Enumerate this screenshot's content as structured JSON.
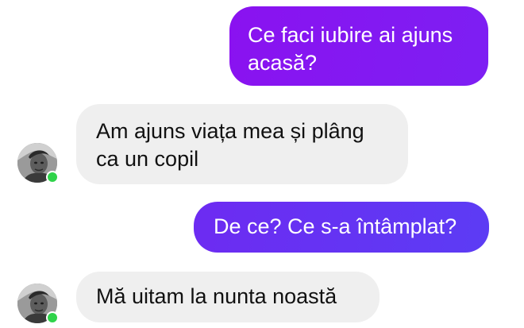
{
  "conversation": {
    "messages": [
      {
        "sender": "me",
        "lines": [
          "Ce faci iubire ai ajuns",
          "acasă?"
        ]
      },
      {
        "sender": "contact",
        "lines": [
          "Am ajuns viața mea și plâng",
          "ca un copil"
        ]
      },
      {
        "sender": "me",
        "lines": [
          "De ce? Ce s-a întâmplat?"
        ]
      },
      {
        "sender": "contact",
        "lines": [
          "Mă uitam la nunta noastă"
        ]
      }
    ],
    "contact_status": "online"
  },
  "colors": {
    "sent_bubble_start": "#8a12f0",
    "sent_bubble_end": "#5c3cf4",
    "received_bubble": "#efefef",
    "online_dot": "#2fd34a"
  },
  "icons": {
    "avatar": "contact-avatar-photo",
    "status": "online-status-dot"
  }
}
